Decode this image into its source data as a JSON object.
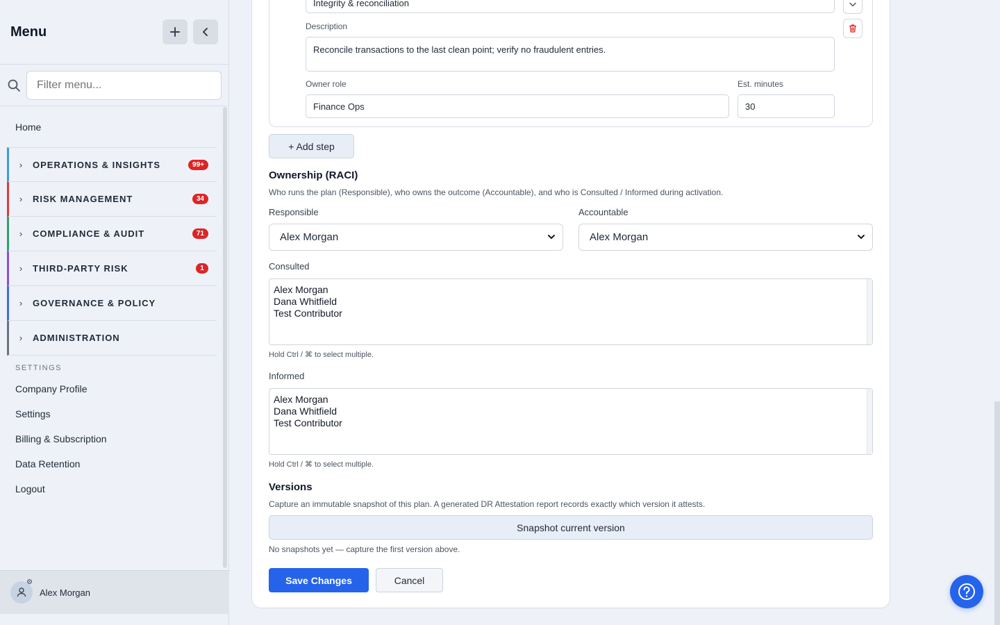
{
  "sidebar": {
    "title": "Menu",
    "add_icon": "plus-icon",
    "collapse_icon": "chevron-left-icon",
    "search": {
      "placeholder": "Filter menu..."
    },
    "home": "Home",
    "groups": [
      {
        "label": "OPERATIONS & INSIGHTS",
        "badge": "99+",
        "color": "#3b9bd6"
      },
      {
        "label": "RISK MANAGEMENT",
        "badge": "34",
        "color": "#d83c3c"
      },
      {
        "label": "COMPLIANCE & AUDIT",
        "badge": "71",
        "color": "#2f9e6e"
      },
      {
        "label": "THIRD-PARTY RISK",
        "badge": "1",
        "color": "#8b4fd6"
      },
      {
        "label": "GOVERNANCE & POLICY",
        "badge": "",
        "color": "#3a6fd8"
      },
      {
        "label": "ADMINISTRATION",
        "badge": "",
        "color": "#6b7280"
      }
    ],
    "settings_header": "SETTINGS",
    "settings_links": [
      "Company Profile",
      "Settings",
      "Billing & Subscription",
      "Data Retention",
      "Logout"
    ],
    "user_name": "Alex Morgan"
  },
  "step": {
    "title_value": "Integrity & reconciliation",
    "description_label": "Description",
    "description_value": "Reconcile transactions to the last clean point; verify no fraudulent entries.",
    "owner_label": "Owner role",
    "owner_value": "Finance Ops",
    "minutes_label": "Est. minutes",
    "minutes_value": "30"
  },
  "add_step_label": "+ Add step",
  "raci": {
    "title": "Ownership (RACI)",
    "description": "Who runs the plan (Responsible), who owns the outcome (Accountable), and who is Consulted / Informed during activation.",
    "responsible_label": "Responsible",
    "responsible_value": "Alex Morgan",
    "accountable_label": "Accountable",
    "accountable_value": "Alex Morgan",
    "consulted_label": "Consulted",
    "consulted_options": [
      "Alex Morgan",
      "Dana Whitfield",
      "Test Contributor"
    ],
    "informed_label": "Informed",
    "informed_options": [
      "Alex Morgan",
      "Dana Whitfield",
      "Test Contributor"
    ],
    "multi_hint": "Hold Ctrl / ⌘ to select multiple."
  },
  "versions": {
    "title": "Versions",
    "description": "Capture an immutable snapshot of this plan. A generated DR Attestation report records exactly which version it attests.",
    "snapshot_button": "Snapshot current version",
    "empty_text": "No snapshots yet — capture the first version above."
  },
  "actions": {
    "save": "Save Changes",
    "cancel": "Cancel"
  },
  "colors": {
    "primary": "#2563eb",
    "badge": "#dc2626"
  }
}
